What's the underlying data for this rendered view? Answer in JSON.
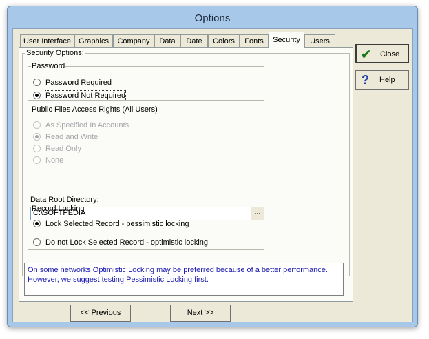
{
  "window": {
    "title": "Options"
  },
  "tabs": [
    {
      "label": "User Interface"
    },
    {
      "label": "Graphics"
    },
    {
      "label": "Company"
    },
    {
      "label": "Data"
    },
    {
      "label": "Date"
    },
    {
      "label": "Colors"
    },
    {
      "label": "Fonts"
    },
    {
      "label": "Security",
      "active": true
    },
    {
      "label": "Users"
    }
  ],
  "security": {
    "legend": "Security Options:",
    "password": {
      "legend": "Password",
      "options": [
        {
          "label": "Password Required",
          "selected": false
        },
        {
          "label": "Password Not Required",
          "selected": true
        }
      ]
    },
    "access": {
      "legend": "Public Files Access Rights (All Users)",
      "options": [
        {
          "label": "As Specified In Accounts",
          "selected": false
        },
        {
          "label": "Read and Write",
          "selected": true
        },
        {
          "label": "Read Only",
          "selected": false
        },
        {
          "label": "None",
          "selected": false
        }
      ]
    },
    "data_root": {
      "label": "Data Root Directory:",
      "value": "C:\\SOFTPEDIA",
      "browse_label": "..."
    },
    "locking": {
      "legend": "Record Locking",
      "options": [
        {
          "label": "Lock Selected Record - pessimistic locking",
          "selected": true
        },
        {
          "label": "Do not Lock Selected Record - optimistic locking",
          "selected": false
        }
      ]
    },
    "info_text": "On some networks Optimistic Locking may be preferred because of a better performance. However, we suggest testing Pessimistic Locking first."
  },
  "buttons": {
    "close": {
      "label": "Close",
      "icon": "checkmark-icon",
      "icon_color": "#1a7a1a"
    },
    "help": {
      "label": "Help",
      "icon": "question-icon",
      "icon_color": "#1a3fa8"
    },
    "previous": "<< Previous",
    "next": "Next >>"
  }
}
